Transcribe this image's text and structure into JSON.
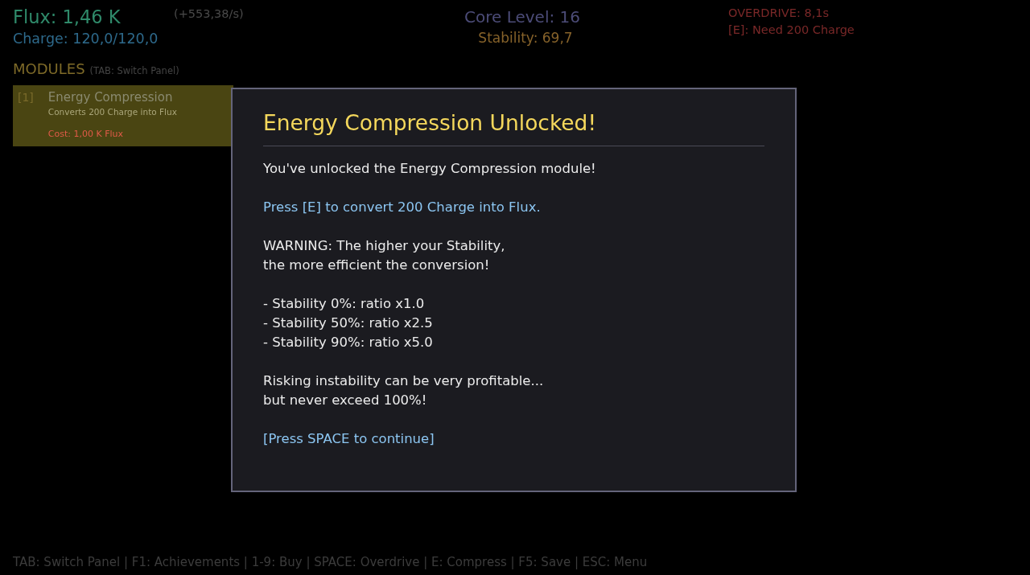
{
  "hud": {
    "flux": "Flux: 1,46 K",
    "flux_rate": "(+553,38/s)",
    "charge": "Charge: 120,0/120,0",
    "core_level": "Core Level: 16",
    "stability": "Stability: 69,7",
    "overdrive": "OVERDRIVE: 8,1s",
    "compress_status": "[E]: Need 200 Charge"
  },
  "modules_panel": {
    "title": "MODULES",
    "hint": "(TAB: Switch Panel)",
    "modules": [
      {
        "key": "[1]",
        "name": "Energy Compression",
        "description": "Converts 200 Charge into Flux",
        "cost": "Cost: 1,00 K Flux",
        "selected": true,
        "affordable": false
      }
    ]
  },
  "dialog": {
    "title": "Energy Compression Unlocked!",
    "blocks": [
      {
        "kind": "text",
        "text": "You've unlocked the Energy Compression module!"
      },
      {
        "kind": "hint",
        "text": "Press [E] to convert 200 Charge into Flux."
      },
      {
        "kind": "text",
        "text": "WARNING: The higher your Stability,\nthe more efficient the conversion!"
      },
      {
        "kind": "list",
        "items": [
          "- Stability 0%: ratio x1.0",
          "- Stability 50%: ratio x2.5",
          "- Stability 90%: ratio x5.0"
        ]
      },
      {
        "kind": "text",
        "text": "Risking instability can be very profitable...\nbut never exceed 100%!"
      },
      {
        "kind": "prompt",
        "text": "[Press SPACE to continue]"
      }
    ]
  },
  "footer": "TAB: Switch Panel | F1: Achievements | 1-9: Buy | SPACE: Overdrive | E: Compress | F5: Save | ESC: Menu"
}
